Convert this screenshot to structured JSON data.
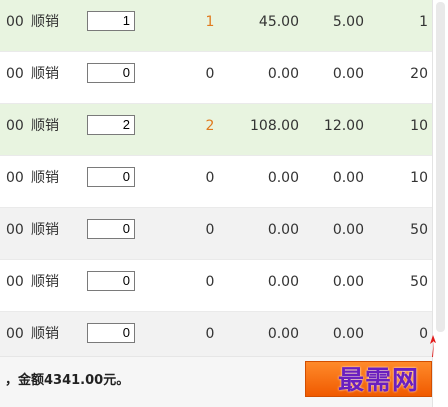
{
  "rows": [
    {
      "price": "00",
      "tag": "顺销",
      "qty": "1",
      "count": "1",
      "amount": "45.00",
      "discount": "5.00",
      "last": "1",
      "highlight": true,
      "count_color": "orange"
    },
    {
      "price": "00",
      "tag": "顺销",
      "qty": "0",
      "count": "0",
      "amount": "0.00",
      "discount": "0.00",
      "last": "20",
      "highlight": false,
      "count_color": "black"
    },
    {
      "price": "00",
      "tag": "顺销",
      "qty": "2",
      "count": "2",
      "amount": "108.00",
      "discount": "12.00",
      "last": "10",
      "highlight": true,
      "count_color": "orange"
    },
    {
      "price": "00",
      "tag": "顺销",
      "qty": "0",
      "count": "0",
      "amount": "0.00",
      "discount": "0.00",
      "last": "10",
      "highlight": false,
      "count_color": "black"
    },
    {
      "price": "00",
      "tag": "顺销",
      "qty": "0",
      "count": "0",
      "amount": "0.00",
      "discount": "0.00",
      "last": "50",
      "highlight": false,
      "count_color": "black"
    },
    {
      "price": "00",
      "tag": "顺销",
      "qty": "0",
      "count": "0",
      "amount": "0.00",
      "discount": "0.00",
      "last": "50",
      "highlight": false,
      "count_color": "black"
    },
    {
      "price": "00",
      "tag": "顺销",
      "qty": "0",
      "count": "0",
      "amount": "0.00",
      "discount": "0.00",
      "last": "0",
      "highlight": false,
      "count_color": "black"
    }
  ],
  "footer": {
    "summary": "，金额4341.00元。",
    "checkout_button_label": ""
  },
  "watermark": {
    "text": "最需网"
  },
  "colors": {
    "highlight_row": "#e8f4e0",
    "count_orange": "#e07a1f",
    "button_orange": "#f05a00",
    "watermark_purple": "#6a1fbf"
  }
}
